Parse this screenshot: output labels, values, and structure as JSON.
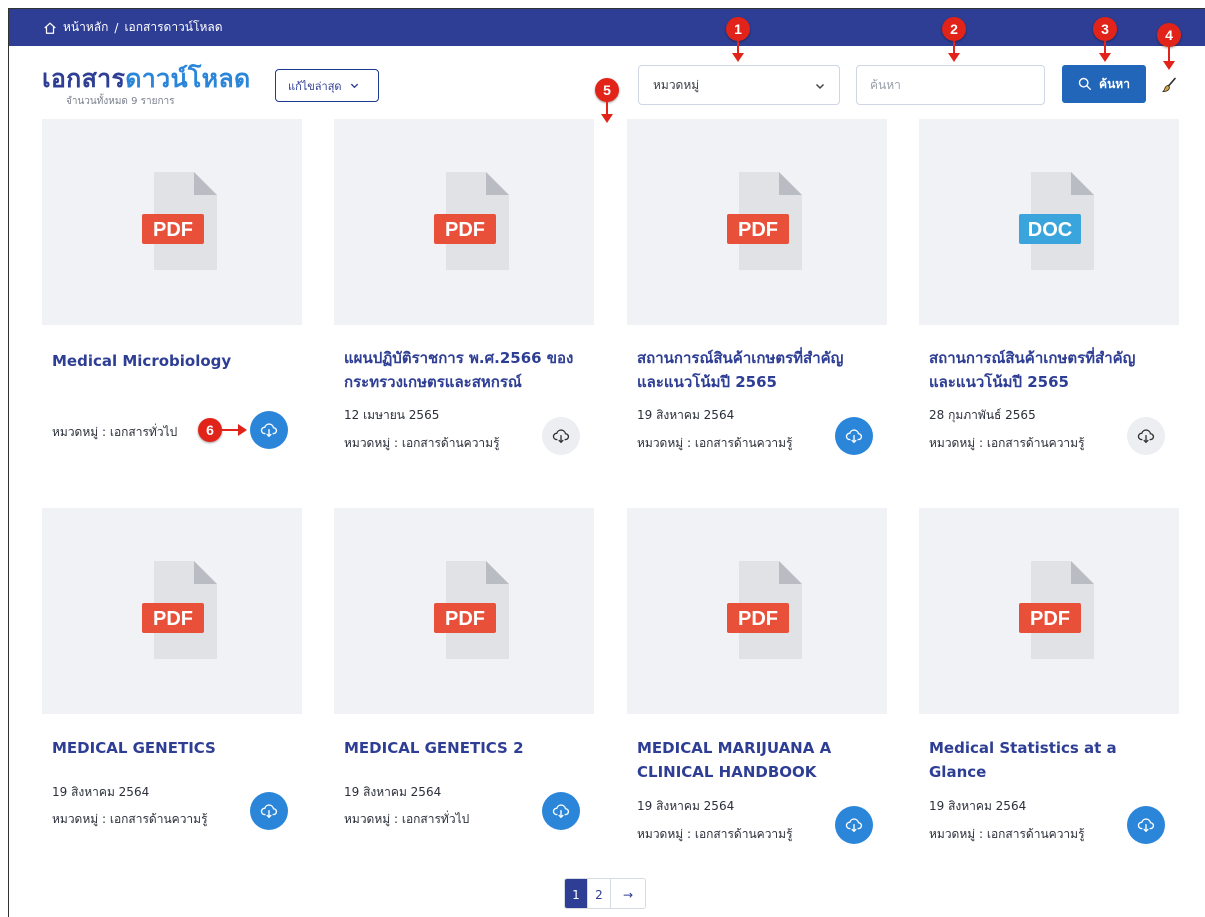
{
  "breadcrumb": {
    "home": "หน้าหลัก",
    "separator": "/",
    "current": "เอกสารดาวน์โหลด"
  },
  "header": {
    "title_part1": "เอกสาร",
    "title_part2": "ดาวน์โหลด",
    "subtitle": "จำนวนทั้งหมด 9 รายการ"
  },
  "filters": {
    "sort_value": "แก้ไขล่าสุด",
    "category_value": "หมวดหมู่",
    "search_placeholder": "ค้นหา",
    "search_button": "ค้นหา"
  },
  "markers": [
    "1",
    "2",
    "3",
    "4",
    "5",
    "6"
  ],
  "colors": {
    "primary": "#2e3e94",
    "accent": "#2b86d9",
    "button": "#2166b8",
    "pdf": "#e8503a",
    "doc": "#3aa5dc",
    "marker": "#e2231a"
  },
  "documents": [
    {
      "title_line1": "Medical Microbiology",
      "title_line2": "",
      "date": "",
      "category": "หมวดหมู่ : เอกสารทั่วไป",
      "file_type": "PDF",
      "download_style": "blue"
    },
    {
      "title_line1": "แผนปฏิบัติราชการ พ.ศ.2566 ของ",
      "title_line2": "กระทรวงเกษตรและสหกรณ์",
      "date": "12 เมษายน 2565",
      "category": "หมวดหมู่ : เอกสารด้านความรู้",
      "file_type": "PDF",
      "download_style": "grey"
    },
    {
      "title_line1": "สถานการณ์สินค้าเกษตรที่สำคัญ",
      "title_line2": "และแนวโน้มปี 2565",
      "date": "19 สิงหาคม 2564",
      "category": "หมวดหมู่ : เอกสารด้านความรู้",
      "file_type": "PDF",
      "download_style": "blue"
    },
    {
      "title_line1": "สถานการณ์สินค้าเกษตรที่สำคัญ",
      "title_line2": "และแนวโน้มปี 2565",
      "date": "28 กุมภาพันธ์ 2565",
      "category": "หมวดหมู่ : เอกสารด้านความรู้",
      "file_type": "DOC",
      "download_style": "grey"
    },
    {
      "title_line1": "MEDICAL GENETICS",
      "title_line2": "",
      "date": "19 สิงหาคม 2564",
      "category": "หมวดหมู่ : เอกสารด้านความรู้",
      "file_type": "PDF",
      "download_style": "blue"
    },
    {
      "title_line1": "MEDICAL GENETICS 2",
      "title_line2": "",
      "date": "19 สิงหาคม 2564",
      "category": "หมวดหมู่ : เอกสารทั่วไป",
      "file_type": "PDF",
      "download_style": "blue"
    },
    {
      "title_line1": "MEDICAL MARIJUANA A",
      "title_line2": "CLINICAL HANDBOOK",
      "date": "19 สิงหาคม 2564",
      "category": "หมวดหมู่ : เอกสารด้านความรู้",
      "file_type": "PDF",
      "download_style": "blue"
    },
    {
      "title_line1": "Medical Statistics at a",
      "title_line2": "Glance",
      "date": "19 สิงหาคม 2564",
      "category": "หมวดหมู่ : เอกสารด้านความรู้",
      "file_type": "PDF",
      "download_style": "blue"
    }
  ],
  "pagination": {
    "pages": [
      "1",
      "2"
    ],
    "current": "1",
    "next": "→"
  }
}
